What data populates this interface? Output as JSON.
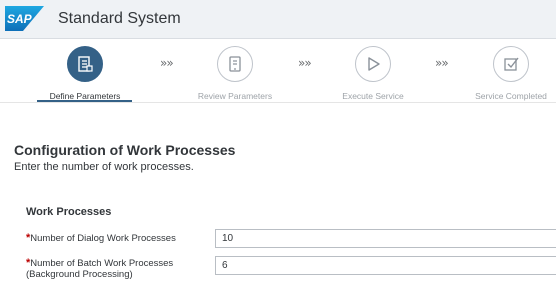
{
  "header": {
    "logo_text": "SAP",
    "title": "Standard System"
  },
  "wizard": {
    "steps": [
      {
        "label": "Define Parameters",
        "icon": "clipboard-list-icon",
        "active": true
      },
      {
        "label": "Review Parameters",
        "icon": "document-icon",
        "active": false
      },
      {
        "label": "Execute Service",
        "icon": "play-icon",
        "active": false
      },
      {
        "label": "Service Completed",
        "icon": "checkbox-icon",
        "active": false
      }
    ],
    "separator": "»»"
  },
  "content": {
    "title": "Configuration of Work Processes",
    "subtitle": "Enter the number of work processes.",
    "group_title": "Work Processes",
    "fields": [
      {
        "required_mark": "*",
        "label_line1": "Number of Dialog Work Processes",
        "label_line2": "",
        "value": "10"
      },
      {
        "required_mark": "*",
        "label_line1": "Number of Batch Work Processes",
        "label_line2": "(Background Processing)",
        "value": "6"
      }
    ]
  },
  "colors": {
    "accent": "#346187",
    "required": "#bb0000",
    "shell_bg": "#eff2f5"
  }
}
